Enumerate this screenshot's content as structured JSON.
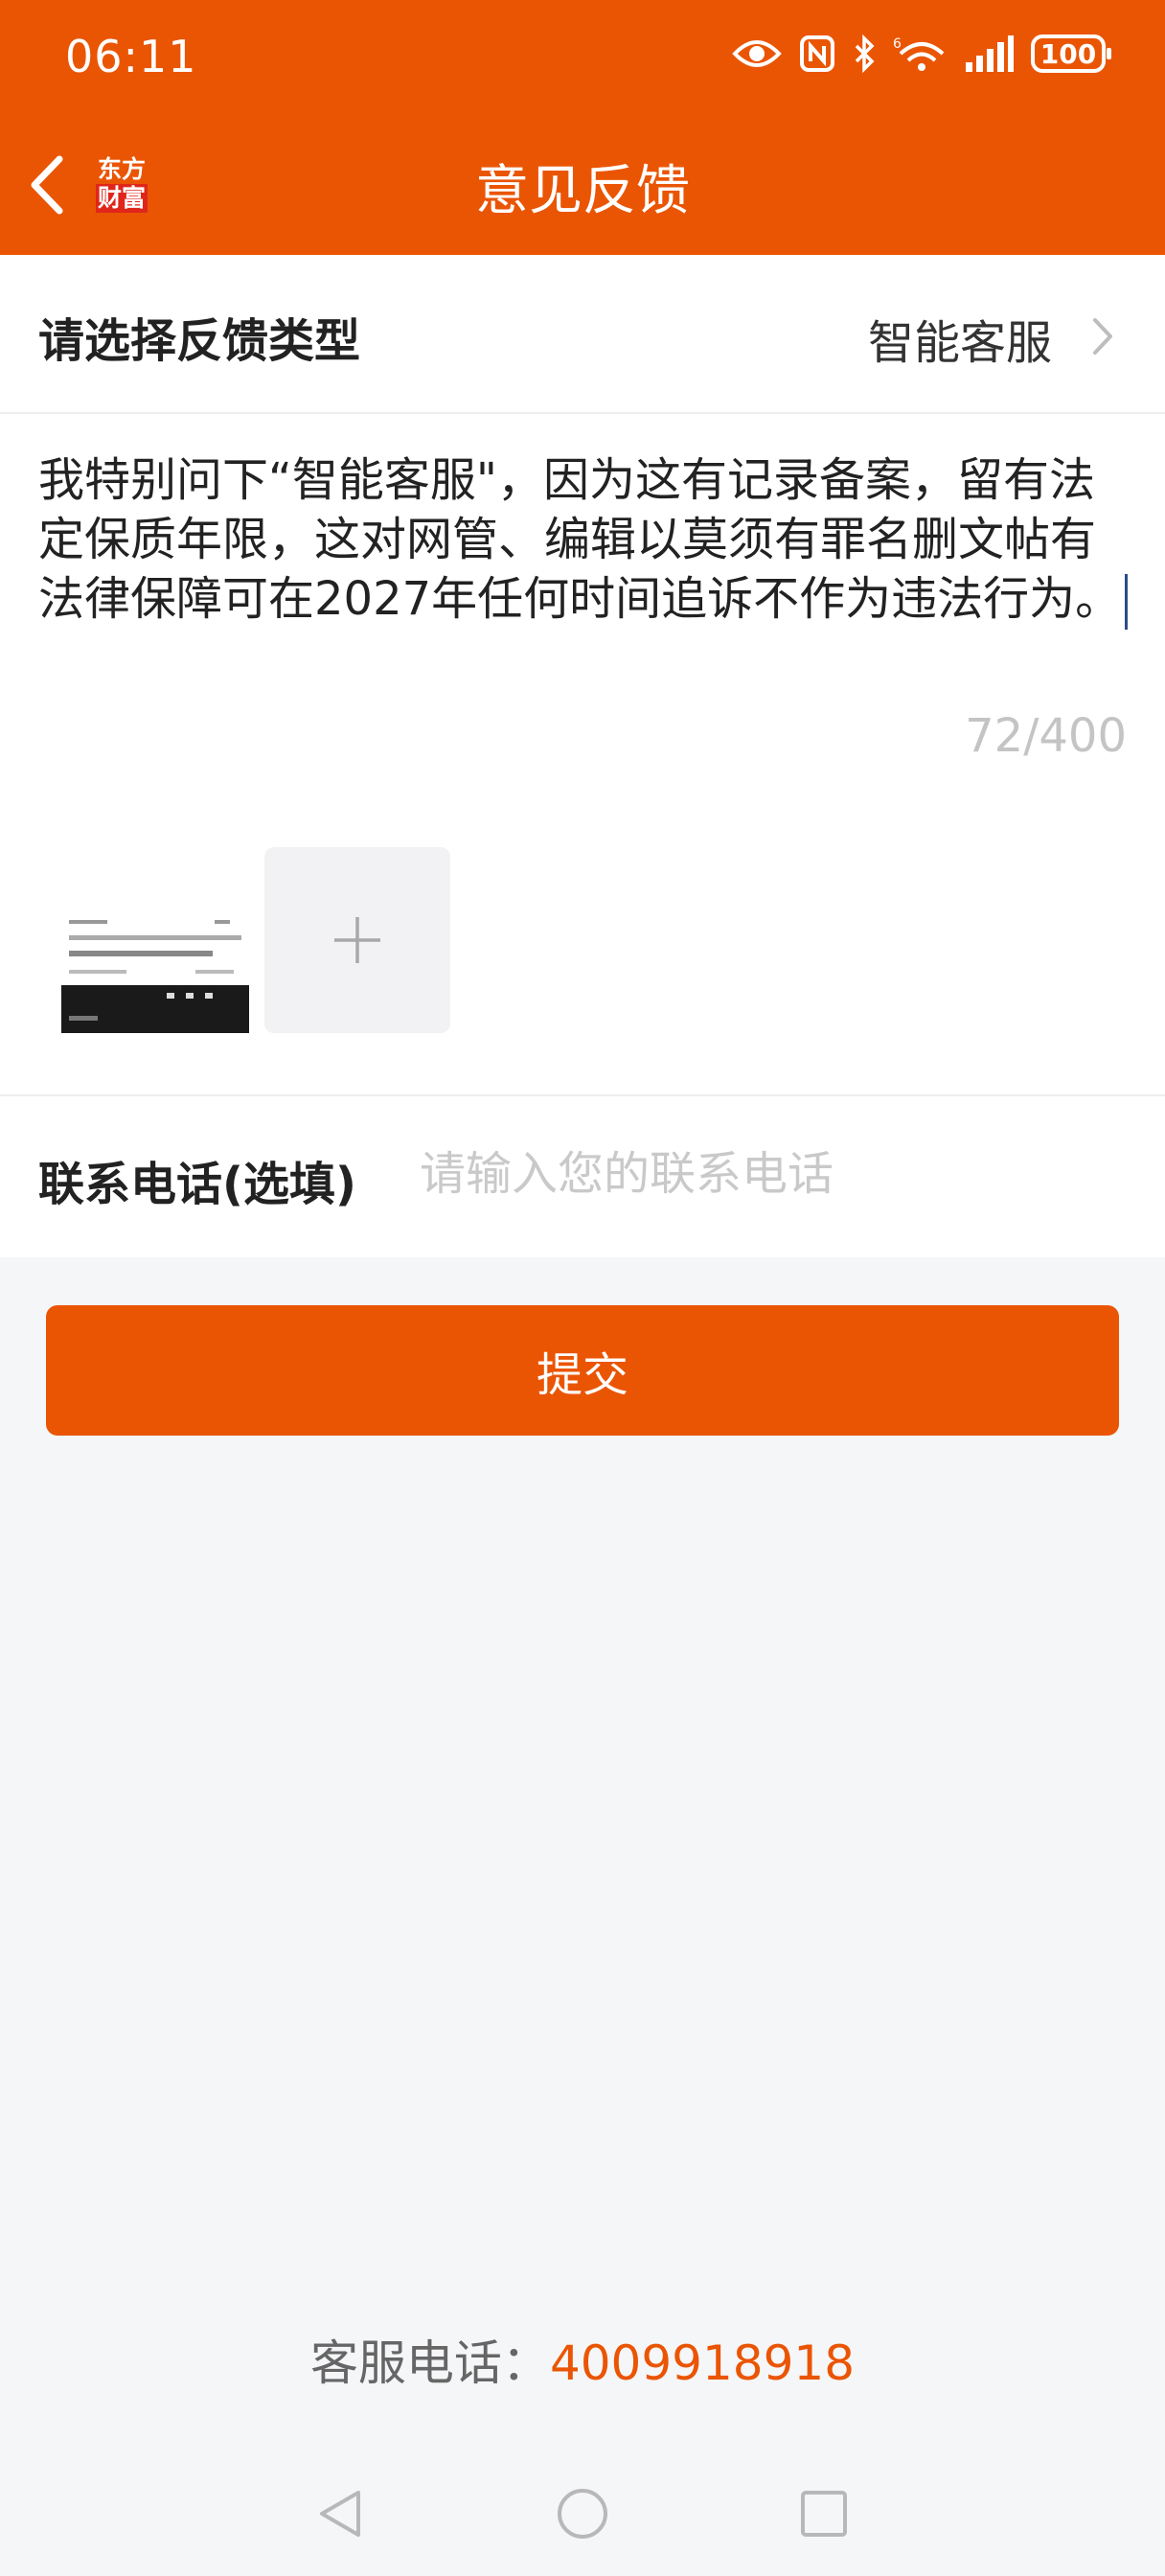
{
  "status_bar": {
    "time": "06:11",
    "battery": "100",
    "icons": [
      "eye-icon",
      "nfc-icon",
      "bluetooth-icon",
      "wifi-6-icon",
      "signal-icon",
      "battery-icon"
    ]
  },
  "nav": {
    "title": "意见反馈",
    "logo_line1": "东方",
    "logo_line2": "财富"
  },
  "feedback_type": {
    "label": "请选择反馈类型",
    "value": "智能客服"
  },
  "feedback": {
    "text": "我特别问下“智能客服\"，因为这有记录备案，留有法定保质年限，这对网管、编辑以莫须有罪名删文帖有法律保障可在2027年任何时间追诉不作为违法行为。",
    "counter": "72/400"
  },
  "contact": {
    "label": "联系电话(选填)",
    "placeholder": "请输入您的联系电话",
    "value": ""
  },
  "submit_label": "提交",
  "hotline": {
    "label": "客服电话：",
    "number": "4009918918"
  },
  "colors": {
    "brand": "#ea5504",
    "background": "#f5f6f8"
  }
}
